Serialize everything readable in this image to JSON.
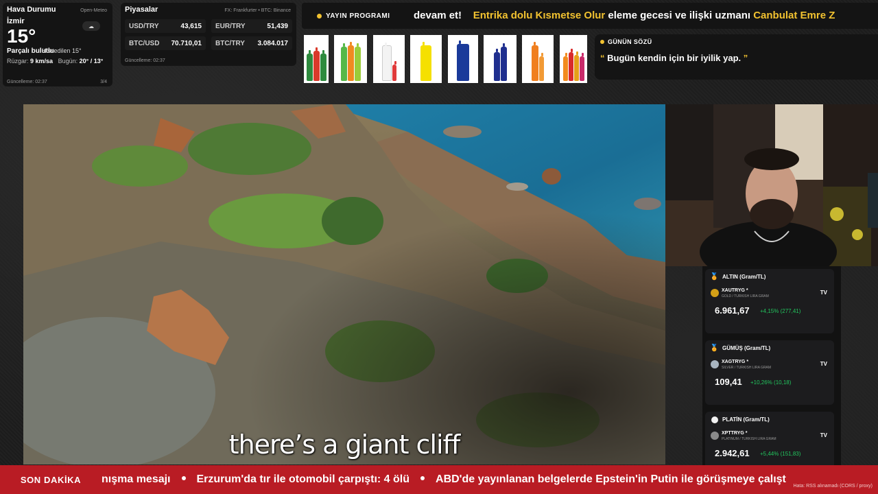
{
  "weather": {
    "title": "Hava Durumu",
    "source": "Open-Meteo",
    "city": "İzmir",
    "temperature": "15°",
    "feels_like": "Hissedilen 15°",
    "condition": "Parçalı bulutlu",
    "wind_label": "Rüzgar:",
    "wind_value": "9 km/sa",
    "today_label": "Bugün:",
    "today_value": "20° / 13°",
    "updated": "Güncelleme: 02:37",
    "page": "3/4",
    "icon": "cloud-icon"
  },
  "markets": {
    "title": "Piyasalar",
    "source": "FX: Frankfurter • BTC: Binance",
    "rates": [
      {
        "name": "USD/TRY",
        "value": "43,615"
      },
      {
        "name": "EUR/TRY",
        "value": "51,439"
      },
      {
        "name": "BTC/USD",
        "value": "70.710,01"
      },
      {
        "name": "BTC/TRY",
        "value": "3.084.017"
      }
    ],
    "updated": "Güncelleme: 02:37"
  },
  "top_ticker": {
    "label": "YAYIN PROGRAMI",
    "part1": "devam et!",
    "part2_highlight": "Entrika dolu Kısmetse Olur",
    "part3": " eleme gecesi ve ilişki uzmanı ",
    "part4_highlight": "Canbulat Emre Z"
  },
  "quote": {
    "title": "GÜNÜN SÖZÜ",
    "open_mark": "“",
    "text": " Bugün kendin için bir iyilik yap. ",
    "close_mark": "”"
  },
  "video": {
    "subtitle": "there’s a giant cliff"
  },
  "metals": [
    {
      "title": "ALTIN (Gram/TL)",
      "symbol": "XAUTRYG",
      "description": "GOLD / TURKISH LIRA GRAM",
      "price": "6.961,67",
      "change": "+4,15% (277,41)",
      "color": "#d4a017",
      "icon": "gold-medal-icon"
    },
    {
      "title": "GÜMÜŞ (Gram/TL)",
      "symbol": "XAGTRYG",
      "description": "SILVER / TURKISH LIRA GRAM",
      "price": "109,41",
      "change": "+10,26% (10,18)",
      "color": "#a8b4c0",
      "icon": "silver-medal-icon"
    },
    {
      "title": "PLATİN (Gram/TL)",
      "symbol": "XPTTRYG",
      "description": "PLATINUM / TURKISH LIRA GRAM",
      "price": "2.942,61",
      "change": "+5,44% (151,83)",
      "color": "#e5e5e5",
      "icon": "platinum-icon"
    }
  ],
  "metals_tv_label": "TV",
  "metals_star": "*",
  "bottom_ticker": {
    "label": "SON DAKİKA",
    "items": [
      "nışma mesajı",
      "Erzurum'da tır ile otomobil çarpıştı: 4 ölü",
      "ABD'de yayınlanan belgelerde Epstein'in Putin ile görüşmeye çalışt"
    ],
    "rss_note": "Hata: RSS alınamadı (CORS / proxy)"
  }
}
